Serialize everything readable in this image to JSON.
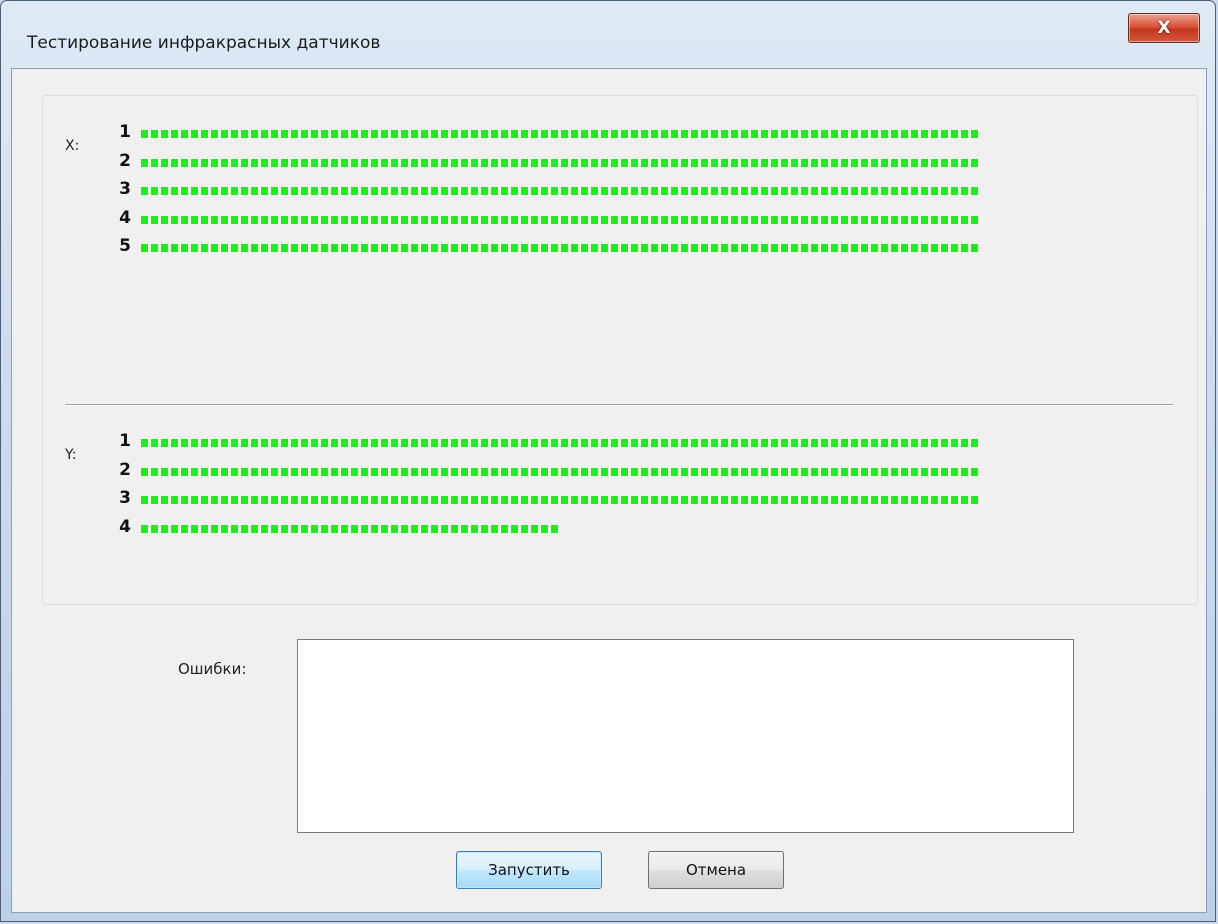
{
  "window": {
    "title": "Тестирование инфракрасных датчиков",
    "close_label": "X"
  },
  "sensors": {
    "x": {
      "label": "X:",
      "rows": [
        {
          "number": "1",
          "fill": 1.0
        },
        {
          "number": "2",
          "fill": 1.0
        },
        {
          "number": "3",
          "fill": 1.0
        },
        {
          "number": "4",
          "fill": 1.0
        },
        {
          "number": "5",
          "fill": 1.0
        }
      ]
    },
    "y": {
      "label": "Y:",
      "rows": [
        {
          "number": "1",
          "fill": 1.0
        },
        {
          "number": "2",
          "fill": 1.0
        },
        {
          "number": "3",
          "fill": 1.0
        },
        {
          "number": "4",
          "fill": 0.5
        }
      ]
    },
    "bar_color": "#18f018"
  },
  "errors": {
    "label": "Ошибки:",
    "value": ""
  },
  "buttons": {
    "start_label": "Запустить",
    "cancel_label": "Отмена"
  }
}
